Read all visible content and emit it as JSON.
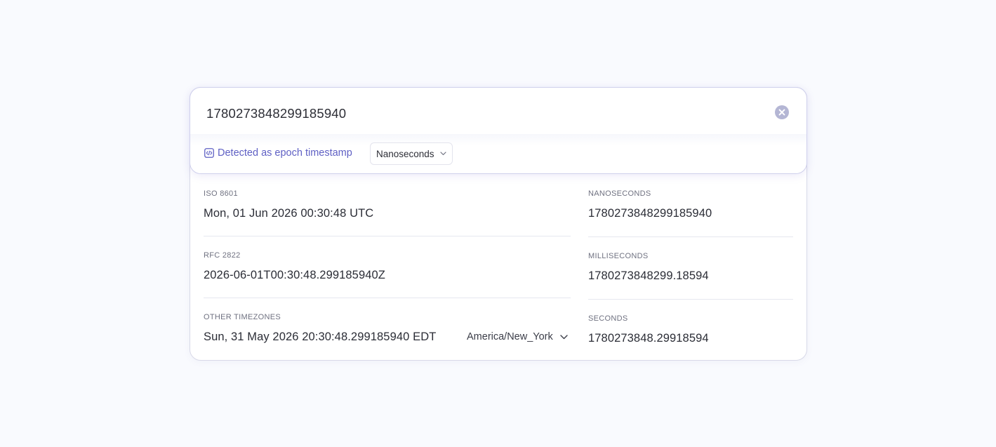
{
  "input": {
    "value": "1780273848299185940",
    "clear_icon": "close-circle-icon"
  },
  "detection": {
    "icon": "code-icon",
    "label": "Detected as epoch timestamp",
    "unit_selected": "Nanoseconds"
  },
  "left_fields": [
    {
      "label": "ISO 8601",
      "value": "Mon, 01 Jun 2026 00:30:48 UTC"
    },
    {
      "label": "RFC 2822",
      "value": "2026-06-01T00:30:48.299185940Z"
    },
    {
      "label": "OTHER TIMEZONES",
      "value": "Sun, 31 May 2026 20:30:48.299185940 EDT",
      "timezone": "America/New_York"
    }
  ],
  "right_fields": [
    {
      "label": "NANOSECONDS",
      "value": "1780273848299185940"
    },
    {
      "label": "MILLISECONDS",
      "value": "1780273848299.18594"
    },
    {
      "label": "SECONDS",
      "value": "1780273848.29918594"
    }
  ],
  "colors": {
    "accent": "#5f60c4",
    "clear_button": "#b4b6d4",
    "background": "#f9fafe"
  }
}
